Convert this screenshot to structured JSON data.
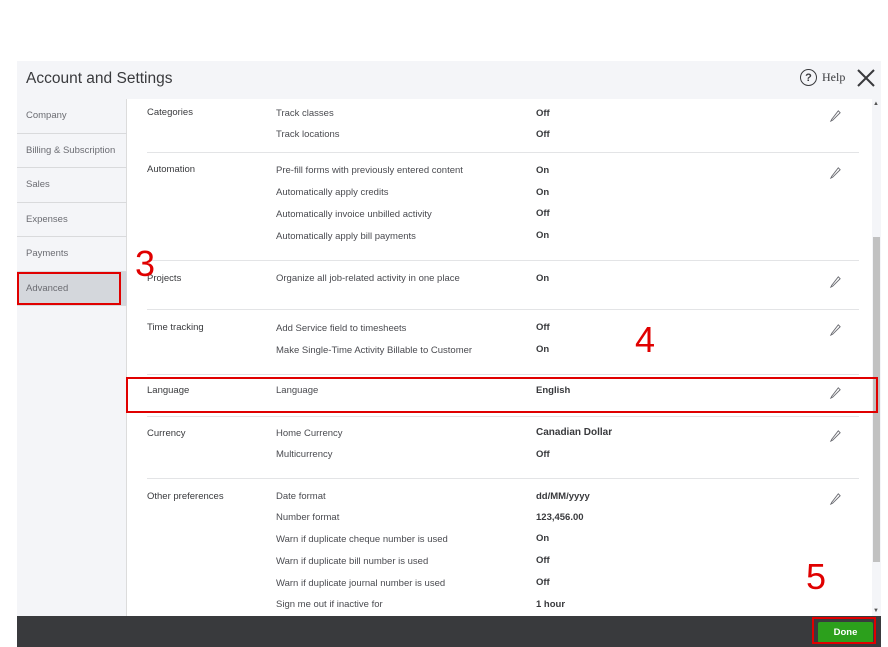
{
  "header": {
    "title": "Account and Settings",
    "help_label": "Help",
    "help_icon": "question-circle-icon",
    "close_icon": "close-icon"
  },
  "sidebar": {
    "items": [
      {
        "label": "Company"
      },
      {
        "label": "Billing & Subscription"
      },
      {
        "label": "Sales"
      },
      {
        "label": "Expenses"
      },
      {
        "label": "Payments"
      },
      {
        "label": "Advanced",
        "active": true
      }
    ]
  },
  "sections": [
    {
      "name": "Categories",
      "rows": [
        {
          "label": "Track classes",
          "value": "Off"
        },
        {
          "label": "Track locations",
          "value": "Off"
        }
      ]
    },
    {
      "name": "Automation",
      "rows": [
        {
          "label": "Pre-fill forms with previously entered content",
          "value": "On"
        },
        {
          "label": "Automatically apply credits",
          "value": "On"
        },
        {
          "label": "Automatically invoice unbilled activity",
          "value": "Off"
        },
        {
          "label": "Automatically apply bill payments",
          "value": "On"
        }
      ]
    },
    {
      "name": "Projects",
      "rows": [
        {
          "label": "Organize all job-related activity in one place",
          "value": "On"
        }
      ]
    },
    {
      "name": "Time tracking",
      "rows": [
        {
          "label": "Add Service field to timesheets",
          "value": "Off"
        },
        {
          "label": "Make Single-Time Activity Billable to Customer",
          "value": "On"
        }
      ]
    },
    {
      "name": "Language",
      "rows": [
        {
          "label": "Language",
          "value": "English"
        }
      ]
    },
    {
      "name": "Currency",
      "rows": [
        {
          "label": "Home Currency",
          "value": "Canadian Dollar"
        },
        {
          "label": "Multicurrency",
          "value": "Off"
        }
      ]
    },
    {
      "name": "Other preferences",
      "rows": [
        {
          "label": "Date format",
          "value": "dd/MM/yyyy"
        },
        {
          "label": "Number format",
          "value": "123,456.00"
        },
        {
          "label": "Warn if duplicate cheque number is used",
          "value": "On"
        },
        {
          "label": "Warn if duplicate bill number is used",
          "value": "Off"
        },
        {
          "label": "Warn if duplicate journal number is used",
          "value": "Off"
        },
        {
          "label": "Sign me out if inactive for",
          "value": "1 hour"
        }
      ]
    }
  ],
  "footer": {
    "done_label": "Done"
  },
  "annotations": {
    "step3": "3",
    "step4": "4",
    "step5": "5",
    "color": "#e00000"
  },
  "colors": {
    "accent_green": "#2ca01c",
    "footer_bg": "#393a3d",
    "panel_bg": "#f4f5f8"
  }
}
